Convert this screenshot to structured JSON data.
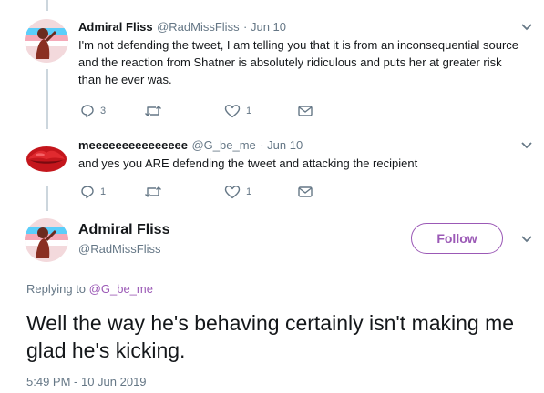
{
  "tweets": [
    {
      "name": "Admiral Fliss",
      "handle": "@RadMissFliss",
      "time": "· Jun 10",
      "text": "I'm not defending the tweet, I am telling you that it is from an inconsequential source and the reaction from Shatner is absolutely ridiculous and puts her at greater risk than he ever was.",
      "reply_count": "3",
      "retweet_count": "",
      "like_count": "1"
    },
    {
      "name": "meeeeeeeeeeeeeee",
      "handle": "@G_be_me",
      "time": "· Jun 10",
      "text": "and yes you ARE defending the tweet and attacking the recipient",
      "reply_count": "1",
      "retweet_count": "",
      "like_count": "1"
    }
  ],
  "main_tweet": {
    "name": "Admiral Fliss",
    "handle": "@RadMissFliss",
    "follow_label": "Follow",
    "replying_to_prefix": "Replying to",
    "replying_to_handle": "@G_be_me",
    "text": "Well the way he's behaving certainly isn't making me glad he's kicking.",
    "timestamp": "5:49 PM - 10 Jun 2019"
  },
  "colors": {
    "accent": "#9b59b6",
    "secondary_text": "#657786",
    "thread_line": "#ccd6dd"
  },
  "icons": [
    "reply-icon",
    "retweet-icon",
    "like-icon",
    "dm-icon",
    "chevron-down-icon"
  ]
}
